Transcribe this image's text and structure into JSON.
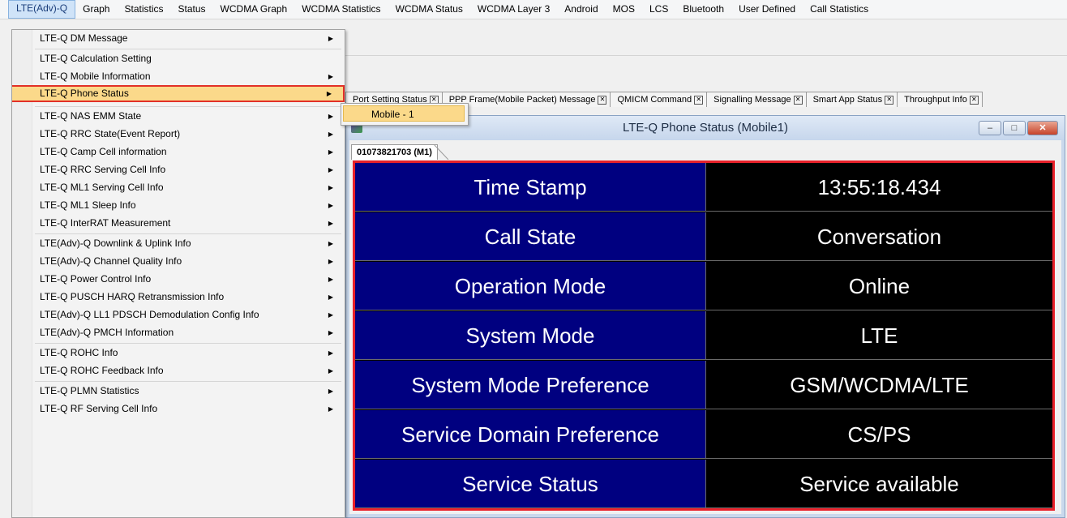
{
  "menubar": {
    "items": [
      "LTE(Adv)-Q",
      "Graph",
      "Statistics",
      "Status",
      "WCDMA Graph",
      "WCDMA Statistics",
      "WCDMA Status",
      "WCDMA Layer 3",
      "Android",
      "MOS",
      "LCS",
      "Bluetooth",
      "User Defined",
      "Call Statistics"
    ]
  },
  "dropdown": {
    "items": [
      {
        "label": "LTE-Q DM Message",
        "submenu": true
      },
      {
        "label": "LTE-Q Calculation Setting",
        "submenu": false
      },
      {
        "label": "LTE-Q Mobile Information",
        "submenu": true
      },
      {
        "label": "LTE-Q Phone Status",
        "submenu": true
      },
      {
        "label": "LTE-Q NAS EMM State",
        "submenu": true
      },
      {
        "label": "LTE-Q RRC State(Event Report)",
        "submenu": true
      },
      {
        "label": "LTE-Q Camp Cell information",
        "submenu": true
      },
      {
        "label": "LTE-Q RRC Serving Cell Info",
        "submenu": true
      },
      {
        "label": "LTE-Q ML1 Serving Cell Info",
        "submenu": true
      },
      {
        "label": "LTE-Q ML1 Sleep Info",
        "submenu": true
      },
      {
        "label": "LTE-Q InterRAT Measurement",
        "submenu": true
      },
      {
        "label": "LTE(Adv)-Q Downlink & Uplink Info",
        "submenu": true
      },
      {
        "label": "LTE(Adv)-Q Channel Quality Info",
        "submenu": true
      },
      {
        "label": "LTE-Q Power Control Info",
        "submenu": true
      },
      {
        "label": "LTE-Q PUSCH HARQ Retransmission Info",
        "submenu": true
      },
      {
        "label": "LTE(Adv)-Q LL1 PDSCH Demodulation Config Info",
        "submenu": true
      },
      {
        "label": "LTE(Adv)-Q PMCH Information",
        "submenu": true
      },
      {
        "label": "LTE-Q ROHC Info",
        "submenu": true
      },
      {
        "label": "LTE-Q ROHC Feedback Info",
        "submenu": true
      },
      {
        "label": "LTE-Q PLMN Statistics",
        "submenu": true
      },
      {
        "label": "LTE-Q RF Serving Cell Info",
        "submenu": true
      }
    ],
    "highlighted_index": 3
  },
  "submenu": {
    "item": "Mobile - 1"
  },
  "doc_tabs": [
    {
      "label": "Port Setting Status"
    },
    {
      "label": "PPP Frame(Mobile Packet) Message"
    },
    {
      "label": "QMICM Command"
    },
    {
      "label": "Signalling Message"
    },
    {
      "label": "Smart App Status"
    },
    {
      "label": "Throughput Info"
    }
  ],
  "window": {
    "title": "LTE-Q Phone Status (Mobile1)",
    "mobile_tab": "01073821703 (M1)",
    "buttons": {
      "minimize": "–",
      "maximize": "□",
      "close": "✕"
    }
  },
  "status_rows": [
    {
      "label": "Time Stamp",
      "value": "13:55:18.434"
    },
    {
      "label": "Call State",
      "value": "Conversation"
    },
    {
      "label": "Operation Mode",
      "value": "Online"
    },
    {
      "label": "System Mode",
      "value": "LTE"
    },
    {
      "label": "System Mode Preference",
      "value": "GSM/WCDMA/LTE"
    },
    {
      "label": "Service Domain Preference",
      "value": "CS/PS"
    },
    {
      "label": "Service Status",
      "value": "Service available"
    }
  ],
  "colors": {
    "highlight": "#fbd98a",
    "highlight_border": "#e23028",
    "label_bg": "#000080",
    "value_bg": "#000000"
  }
}
